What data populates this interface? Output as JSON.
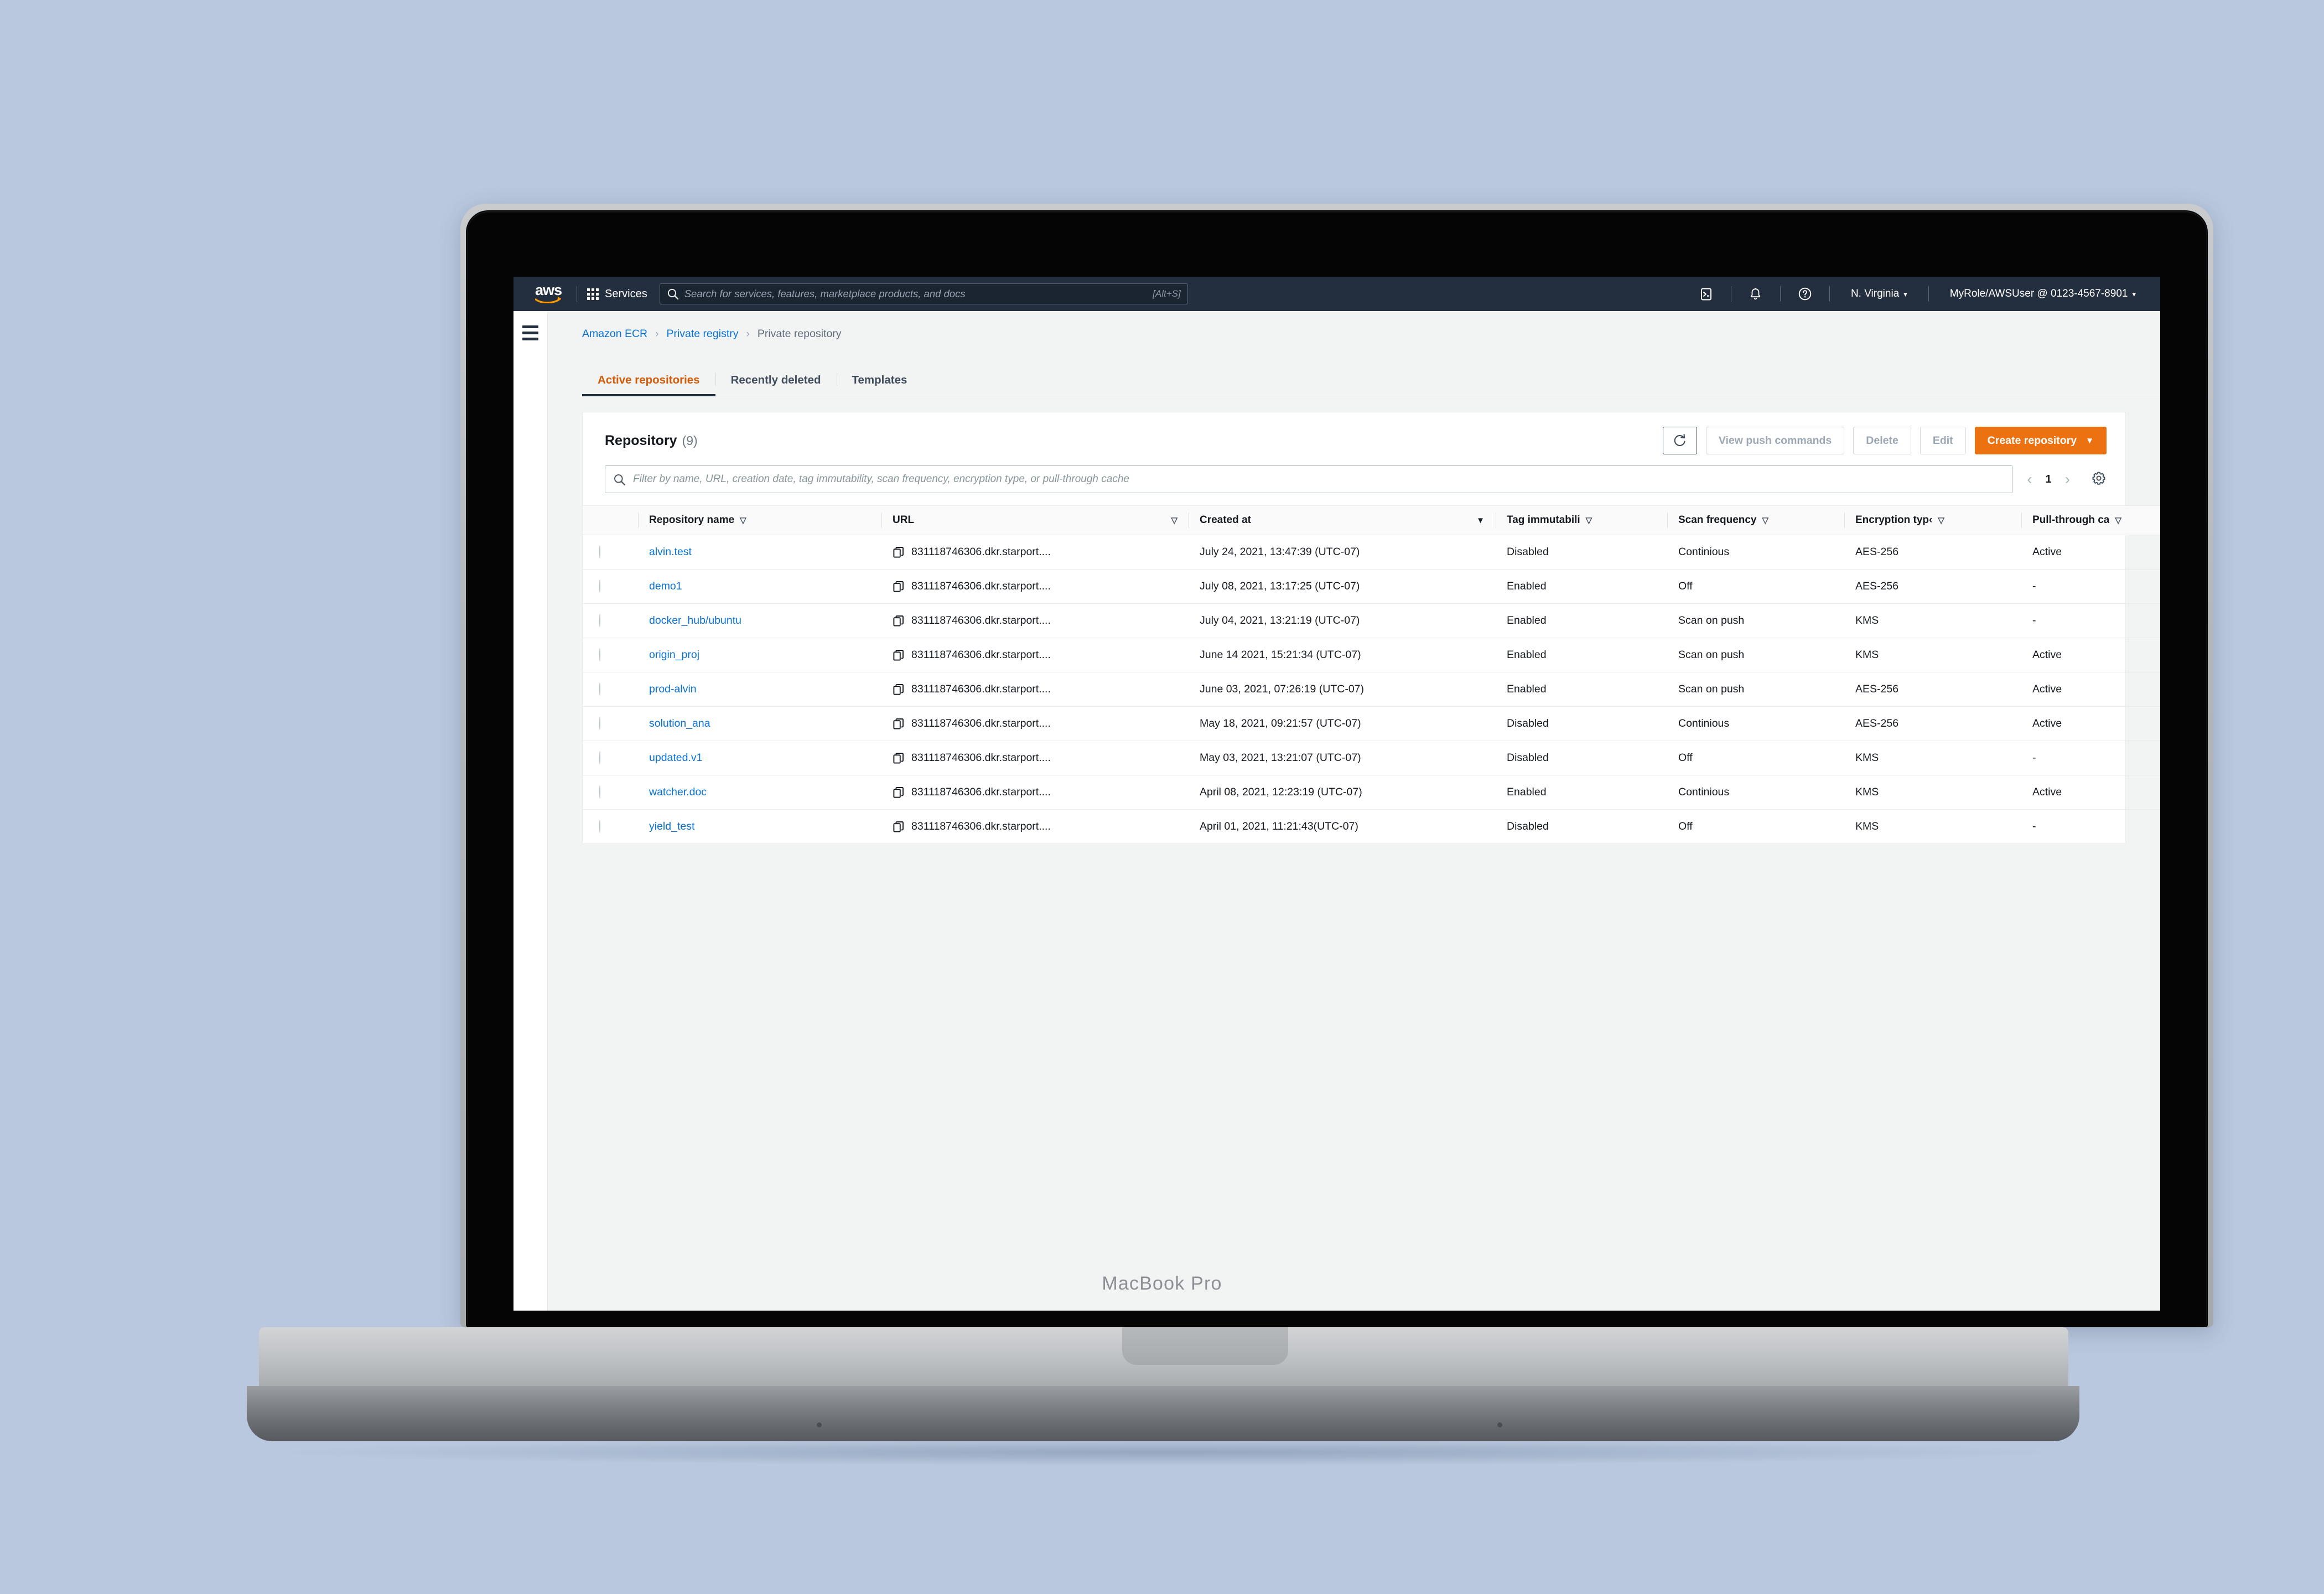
{
  "device": {
    "label": "MacBook Pro"
  },
  "aws_nav": {
    "logo_alt": "aws",
    "services_label": "Services",
    "search_placeholder": "Search for services, features, marketplace products, and docs",
    "search_value": "",
    "search_shortcut": "[Alt+S]",
    "cloudshell_icon": "cloudshell-icon",
    "notifications_icon": "bell-icon",
    "help_icon": "help-icon",
    "region_label": "N. Virginia",
    "account_label": "MyRole/AWSUser @ 0123-4567-8901",
    "caret": "▾"
  },
  "breadcrumb": [
    {
      "label": "Amazon ECR",
      "link": true
    },
    {
      "label": "Private registry",
      "link": true
    },
    {
      "label": "Private repository",
      "link": false
    }
  ],
  "breadcrumb_separator": "›",
  "tabs": [
    {
      "label": "Active repositories",
      "active": true
    },
    {
      "label": "Recently deleted",
      "active": false
    },
    {
      "label": "Templates",
      "active": false
    }
  ],
  "panel": {
    "title": "Repository",
    "count": "(9)",
    "refresh_icon": "refresh-icon",
    "buttons": [
      {
        "label": "View push commands",
        "state": "disabled"
      },
      {
        "label": "Delete",
        "state": "disabled"
      },
      {
        "label": "Edit",
        "state": "disabled"
      }
    ],
    "primary_button": {
      "label": "Create repository",
      "caret": "▼",
      "color": "#ec7211"
    }
  },
  "filter": {
    "icon": "search-icon",
    "placeholder": "Filter by name, URL, creation date, tag immutability, scan frequency, encryption type, or pull-through cache",
    "value": ""
  },
  "pagination": {
    "prev": "‹",
    "page": "1",
    "next": "›",
    "settings_icon": "gear-icon"
  },
  "table": {
    "columns": [
      {
        "key": "select",
        "label": "",
        "sortable": false
      },
      {
        "key": "name",
        "label": "Repository name",
        "sort": "outline"
      },
      {
        "key": "url",
        "label": "URL",
        "sort": "outline"
      },
      {
        "key": "created",
        "label": "Created at",
        "sort": "filled"
      },
      {
        "key": "tag",
        "label": "Tag immutabili",
        "sort": "outline"
      },
      {
        "key": "scan",
        "label": "Scan frequency",
        "sort": "outline"
      },
      {
        "key": "encryption",
        "label": "Encryption typ‹",
        "sort": "outline"
      },
      {
        "key": "pullthrough",
        "label": "Pull-through ca",
        "sort": "outline"
      }
    ],
    "rows": [
      {
        "name": "alvin.test",
        "url": "831118746306.dkr.starport....",
        "created": "July 24, 2021, 13:47:39 (UTC-07)",
        "tag": "Disabled",
        "scan": "Continious",
        "encryption": "AES-256",
        "pullthrough": "Active"
      },
      {
        "name": "demo1",
        "url": "831118746306.dkr.starport....",
        "created": "July 08, 2021, 13:17:25 (UTC-07)",
        "tag": "Enabled",
        "scan": "Off",
        "encryption": "AES-256",
        "pullthrough": "-"
      },
      {
        "name": "docker_hub/ubuntu",
        "url": "831118746306.dkr.starport....",
        "created": "July 04, 2021, 13:21:19 (UTC-07)",
        "tag": "Enabled",
        "scan": "Scan on push",
        "encryption": "KMS",
        "pullthrough": "-"
      },
      {
        "name": "origin_proj",
        "url": "831118746306.dkr.starport....",
        "created": "June 14 2021, 15:21:34 (UTC-07)",
        "tag": "Enabled",
        "scan": "Scan on push",
        "encryption": "KMS",
        "pullthrough": "Active"
      },
      {
        "name": "prod-alvin",
        "url": "831118746306.dkr.starport....",
        "created": "June 03, 2021, 07:26:19 (UTC-07)",
        "tag": "Enabled",
        "scan": "Scan on push",
        "encryption": "AES-256",
        "pullthrough": "Active"
      },
      {
        "name": "solution_ana",
        "url": "831118746306.dkr.starport....",
        "created": "May 18, 2021, 09:21:57 (UTC-07)",
        "tag": "Disabled",
        "scan": "Continious",
        "encryption": "AES-256",
        "pullthrough": "Active"
      },
      {
        "name": "updated.v1",
        "url": "831118746306.dkr.starport....",
        "created": "May 03, 2021, 13:21:07 (UTC-07)",
        "tag": "Disabled",
        "scan": "Off",
        "encryption": "KMS",
        "pullthrough": "-"
      },
      {
        "name": "watcher.doc",
        "url": "831118746306.dkr.starport....",
        "created": "April 08, 2021, 12:23:19 (UTC-07)",
        "tag": "Enabled",
        "scan": "Continious",
        "encryption": "KMS",
        "pullthrough": "Active"
      },
      {
        "name": "yield_test",
        "url": "831118746306.dkr.starport....",
        "created": "April 01, 2021, 11:21:43(UTC-07)",
        "tag": "Disabled",
        "scan": "Off",
        "encryption": "KMS",
        "pullthrough": "-"
      }
    ]
  },
  "colors": {
    "nav_bg": "#232f3e",
    "accent_orange": "#ec7211",
    "link_blue": "#0972d3",
    "page_bg": "#f2f3f3",
    "desktop_bg": "#b9c8de"
  }
}
